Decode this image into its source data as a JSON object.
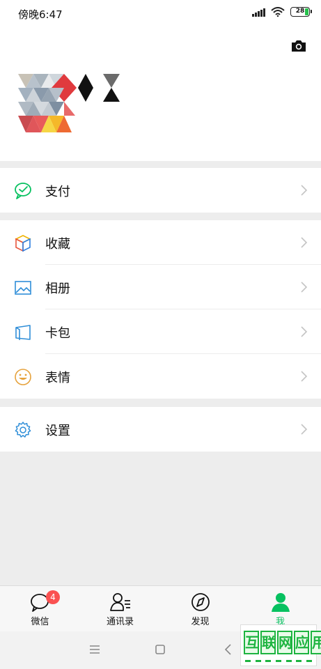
{
  "status_bar": {
    "time": "傍晚6:47",
    "battery": "28"
  },
  "menu_groups": [
    {
      "items": [
        {
          "label": "支付",
          "icon": "wechat-pay-icon"
        }
      ]
    },
    {
      "items": [
        {
          "label": "收藏",
          "icon": "favorites-cube-icon"
        },
        {
          "label": "相册",
          "icon": "album-image-icon"
        },
        {
          "label": "卡包",
          "icon": "card-wallet-icon"
        },
        {
          "label": "表情",
          "icon": "smiley-icon"
        }
      ]
    },
    {
      "items": [
        {
          "label": "设置",
          "icon": "gear-icon"
        }
      ]
    }
  ],
  "tabbar": {
    "tabs": [
      {
        "label": "微信",
        "icon": "chat-bubble-icon",
        "badge": "4"
      },
      {
        "label": "通讯录",
        "icon": "contacts-icon"
      },
      {
        "label": "发现",
        "icon": "compass-icon"
      },
      {
        "label": "我",
        "icon": "me-person-icon",
        "active": true
      }
    ]
  },
  "watermark": {
    "chars": [
      "互",
      "联",
      "网",
      "应",
      "用"
    ]
  },
  "colors": {
    "accent": "#07c160",
    "badge": "#fa5151",
    "background": "#ededed"
  }
}
